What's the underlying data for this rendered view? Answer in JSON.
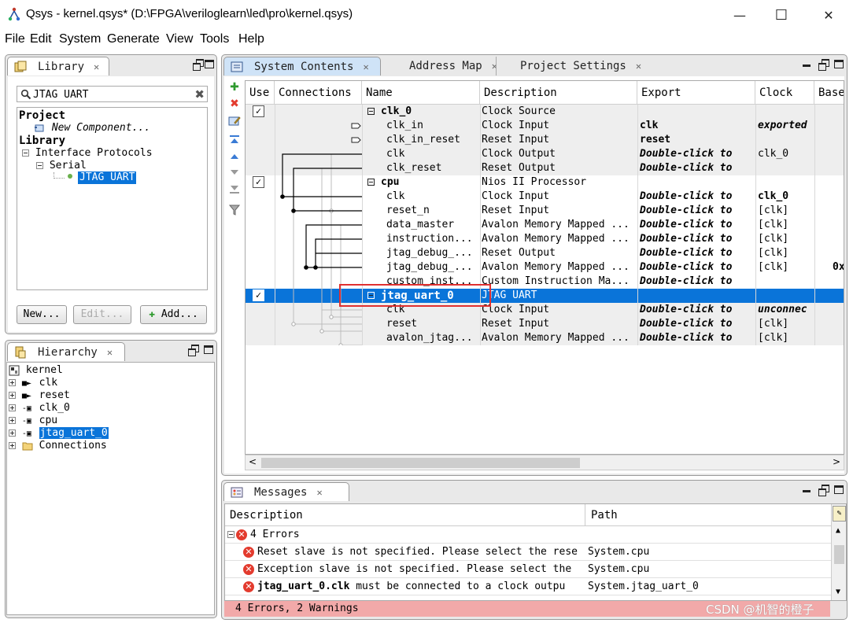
{
  "window": {
    "title": "Qsys - kernel.qsys* (D:\\FPGA\\veriloglearn\\led\\pro\\kernel.qsys)",
    "minimize": "—",
    "maximize": "☐",
    "close": "✕"
  },
  "menu": [
    "File",
    "Edit",
    "System",
    "Generate",
    "View",
    "Tools",
    "Help"
  ],
  "library": {
    "tab_label": "Library",
    "search_value": "JTAG UART",
    "tree": {
      "project": "Project",
      "new_component": "New Component...",
      "library": "Library",
      "interface_protocols": "Interface Protocols",
      "serial": "Serial",
      "jtag_uart": "JTAG UART"
    },
    "buttons": {
      "new": "New...",
      "edit": "Edit...",
      "add": "Add..."
    }
  },
  "hierarchy": {
    "tab_label": "Hierarchy",
    "root": "kernel",
    "items": [
      "clk",
      "reset",
      "clk_0",
      "cpu",
      "jtag_uart_0",
      "Connections"
    ]
  },
  "tabs": {
    "system_contents": "System Contents",
    "address_map": "Address Map",
    "project_settings": "Project Settings"
  },
  "system_table": {
    "columns": [
      "Use",
      "Connections",
      "Name",
      "Description",
      "Export",
      "Clock",
      "Base"
    ],
    "rows": [
      {
        "name": "clk_0",
        "desc": "Clock Source",
        "export": "",
        "clock": "",
        "base": ""
      },
      {
        "name": "clk_in",
        "desc": "Clock Input",
        "export": "clk",
        "clock": "exported",
        "base": ""
      },
      {
        "name": "clk_in_reset",
        "desc": "Reset Input",
        "export": "reset",
        "clock": "",
        "base": ""
      },
      {
        "name": "clk",
        "desc": "Clock Output",
        "export": "Double-click to",
        "clock": "clk_0",
        "base": ""
      },
      {
        "name": "clk_reset",
        "desc": "Reset Output",
        "export": "Double-click to",
        "clock": "",
        "base": ""
      },
      {
        "name": "cpu",
        "desc": "Nios II Processor",
        "export": "",
        "clock": "",
        "base": ""
      },
      {
        "name": "clk",
        "desc": "Clock Input",
        "export": "Double-click to",
        "clock": "clk_0",
        "base": ""
      },
      {
        "name": "reset_n",
        "desc": "Reset Input",
        "export": "Double-click to",
        "clock": "[clk]",
        "base": ""
      },
      {
        "name": "data_master",
        "desc": "Avalon Memory Mapped ...",
        "export": "Double-click to",
        "clock": "[clk]",
        "base": ""
      },
      {
        "name": "instruction...",
        "desc": "Avalon Memory Mapped ...",
        "export": "Double-click to",
        "clock": "[clk]",
        "base": ""
      },
      {
        "name": "jtag_debug_...",
        "desc": "Reset Output",
        "export": "Double-click to",
        "clock": "[clk]",
        "base": ""
      },
      {
        "name": "jtag_debug_...",
        "desc": "Avalon Memory Mapped ...",
        "export": "Double-click to",
        "clock": "[clk]",
        "base": "0x"
      },
      {
        "name": "custom_inst...",
        "desc": "Custom Instruction Ma...",
        "export": "Double-click to",
        "clock": "",
        "base": ""
      },
      {
        "name": "jtag_uart_0",
        "desc": "JTAG UART",
        "export": "",
        "clock": "",
        "base": ""
      },
      {
        "name": "clk",
        "desc": "Clock Input",
        "export": "Double-click to",
        "clock": "unconnec",
        "base": ""
      },
      {
        "name": "reset",
        "desc": "Reset Input",
        "export": "Double-click to",
        "clock": "[clk]",
        "base": ""
      },
      {
        "name": "avalon_jtag...",
        "desc": "Avalon Memory Mapped ...",
        "export": "Double-click to",
        "clock": "[clk]",
        "base": ""
      }
    ]
  },
  "messages": {
    "tab_label": "Messages",
    "columns": [
      "Description",
      "Path"
    ],
    "group": "4 Errors",
    "rows": [
      {
        "pre": "",
        "bold": "",
        "text": "Reset slave is not specified. Please select the rese",
        "path": "System.cpu"
      },
      {
        "pre": "",
        "bold": "",
        "text": "Exception slave is not specified. Please select the",
        "path": "System.cpu"
      },
      {
        "pre": "",
        "bold": "jtag_uart_0.clk",
        "text": " must be connected to a clock outpu",
        "path": "System.jtag_uart_0"
      }
    ],
    "status": "4 Errors, 2 Warnings"
  },
  "watermark": "CSDN @机智的橙子",
  "colors": {
    "selection": "#0a74d9",
    "error": "#e33b2e",
    "status_bg": "#f2a9a9",
    "highlight_box": "#e03030"
  }
}
